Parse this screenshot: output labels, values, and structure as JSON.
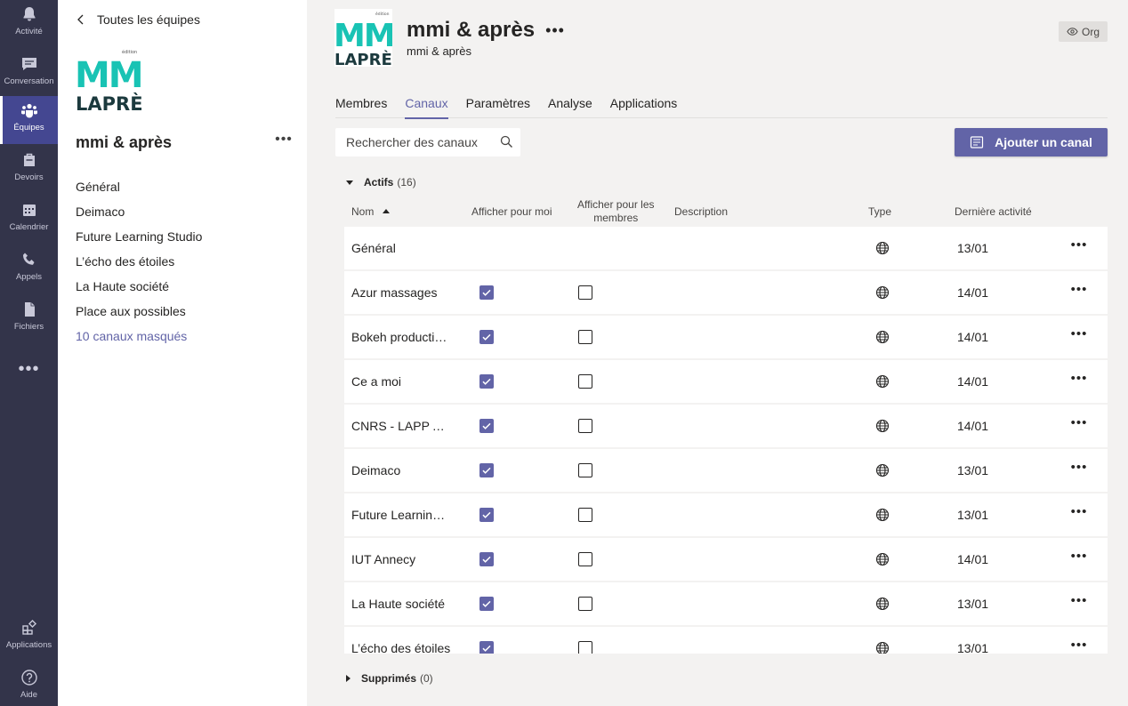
{
  "rail": {
    "items": [
      {
        "label": "Activité",
        "icon": "bell-icon"
      },
      {
        "label": "Conversation",
        "icon": "chat-icon"
      },
      {
        "label": "Équipes",
        "icon": "teams-icon"
      },
      {
        "label": "Devoirs",
        "icon": "assignments-icon"
      },
      {
        "label": "Calendrier",
        "icon": "calendar-icon"
      },
      {
        "label": "Appels",
        "icon": "phone-icon"
      },
      {
        "label": "Fichiers",
        "icon": "file-icon"
      }
    ],
    "more": "•••",
    "bottom": [
      {
        "label": "Applications",
        "icon": "apps-icon"
      },
      {
        "label": "Aide",
        "icon": "help-icon"
      }
    ]
  },
  "sidebar": {
    "back_label": "Toutes les équipes",
    "logo": {
      "top_text": "édition",
      "mid_text": "MM",
      "bottom_text": "LAPRÈ"
    },
    "team_name": "mmi & après",
    "more": "•••",
    "channels": [
      "Général",
      "Deimaco",
      "Future Learning Studio",
      "L’écho des étoiles",
      "La Haute société",
      "Place aux possibles"
    ],
    "hidden_link": "10 canaux masqués"
  },
  "header": {
    "title": "mmi & après",
    "more": "•••",
    "subtitle": "mmi & après",
    "badge": "Org"
  },
  "tabs": [
    {
      "label": "Membres",
      "active": false
    },
    {
      "label": "Canaux",
      "active": true
    },
    {
      "label": "Paramètres",
      "active": false
    },
    {
      "label": "Analyse",
      "active": false
    },
    {
      "label": "Applications",
      "active": false
    }
  ],
  "search": {
    "placeholder": "Rechercher des canaux"
  },
  "add_channel_label": "Ajouter un canal",
  "active_section": {
    "label": "Actifs",
    "count": "(16)"
  },
  "deleted_section": {
    "label": "Supprimés",
    "count": "(0)"
  },
  "columns": {
    "name": "Nom",
    "show_me": "Afficher pour moi",
    "show_members_1": "Afficher pour les",
    "show_members_2": "membres",
    "description": "Description",
    "type": "Type",
    "last_activity": "Dernière activité"
  },
  "rows": [
    {
      "name": "Général",
      "show_me": null,
      "show_members": null,
      "date": "13/01"
    },
    {
      "name": "Azur massages",
      "show_me": true,
      "show_members": false,
      "date": "14/01"
    },
    {
      "name": "Bokeh productions",
      "show_me": true,
      "show_members": false,
      "date": "14/01"
    },
    {
      "name": "Ce a moi",
      "show_me": true,
      "show_members": false,
      "date": "14/01"
    },
    {
      "name": "CNRS - LAPP Annecy",
      "show_me": true,
      "show_members": false,
      "date": "14/01"
    },
    {
      "name": "Deimaco",
      "show_me": true,
      "show_members": false,
      "date": "13/01"
    },
    {
      "name": "Future Learning Studio",
      "show_me": true,
      "show_members": false,
      "date": "13/01"
    },
    {
      "name": "IUT Annecy",
      "show_me": true,
      "show_members": false,
      "date": "14/01"
    },
    {
      "name": "La Haute société",
      "show_me": true,
      "show_members": false,
      "date": "13/01"
    },
    {
      "name": "L’écho des étoiles",
      "show_me": true,
      "show_members": false,
      "date": "13/01"
    }
  ],
  "row_more": "•••",
  "colors": {
    "accent": "#6264a7",
    "rail": "#33344a",
    "rail_active": "#444791",
    "logo_teal": "#19c3b4",
    "logo_dark": "#1c3a3e"
  }
}
